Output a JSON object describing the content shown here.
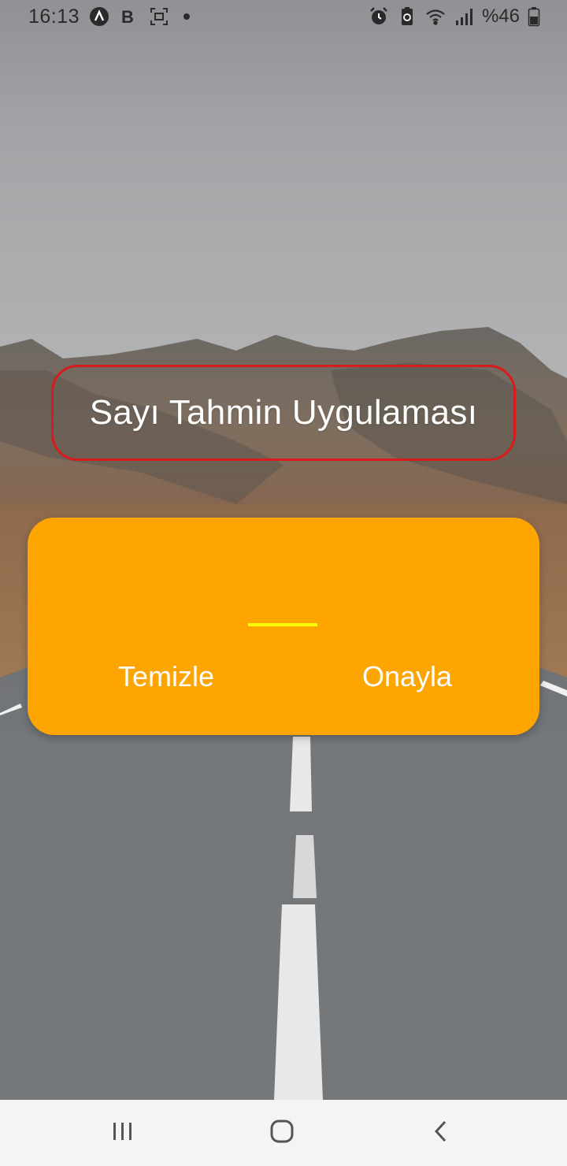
{
  "status_bar": {
    "time": "16:13",
    "battery": "%46",
    "left_icons": [
      "navigation-icon",
      "b-icon",
      "screenshot-icon",
      "dot-icon"
    ],
    "right_icons": [
      "alarm-icon",
      "battery-saver-icon",
      "wifi-icon",
      "signal-icon",
      "battery-icon"
    ]
  },
  "app": {
    "title": "Sayı Tahmin Uygulaması",
    "guess_input": {
      "value": "",
      "placeholder": ""
    },
    "clear_button_label": "Temizle",
    "confirm_button_label": "Onayla"
  },
  "nav_bar": {
    "icons": [
      "recent-apps-icon",
      "home-icon",
      "back-icon"
    ]
  },
  "colors": {
    "card_background": "#FFA500",
    "title_border": "#D81B1B",
    "input_underline": "#FFFF00",
    "text": "#FFFFFF",
    "nav_background": "#F4F4F4"
  }
}
